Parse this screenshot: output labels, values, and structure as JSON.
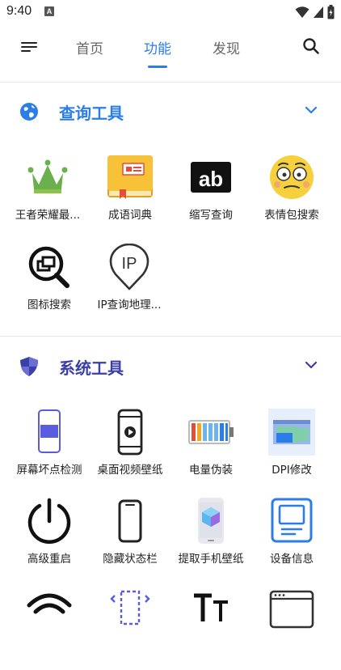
{
  "status_bar": {
    "time": "9:40",
    "notification_badge": "A"
  },
  "app_bar": {
    "tabs": [
      {
        "label": "首页",
        "active": false
      },
      {
        "label": "功能",
        "active": true
      },
      {
        "label": "发现",
        "active": false
      }
    ]
  },
  "colors": {
    "accent": "#2b7de9",
    "section2_title": "#3b3fa8"
  },
  "sections": [
    {
      "title": "查询工具",
      "icon": "globe-icon",
      "items": [
        {
          "label": "王者荣耀最...",
          "icon": "crown-icon"
        },
        {
          "label": "成语词典",
          "icon": "book-icon"
        },
        {
          "label": "缩写查询",
          "icon": "ab-icon"
        },
        {
          "label": "表情包搜索",
          "icon": "emoji-face-icon"
        },
        {
          "label": "图标搜索",
          "icon": "magnifier-icon"
        },
        {
          "label": "IP查询地理...",
          "icon": "ip-location-icon"
        }
      ]
    },
    {
      "title": "系统工具",
      "icon": "shield-icon",
      "items": [
        {
          "label": "屏幕坏点检测",
          "icon": "phone-screen-icon"
        },
        {
          "label": "桌面视频壁纸",
          "icon": "phone-play-icon"
        },
        {
          "label": "电量伪装",
          "icon": "battery-icon"
        },
        {
          "label": "DPI修改",
          "icon": "dpi-window-icon"
        },
        {
          "label": "高级重启",
          "icon": "power-icon"
        },
        {
          "label": "隐藏状态栏",
          "icon": "phone-outline-icon"
        },
        {
          "label": "提取手机壁纸",
          "icon": "phone-cube-icon"
        },
        {
          "label": "设备信息",
          "icon": "device-info-icon"
        }
      ]
    }
  ]
}
